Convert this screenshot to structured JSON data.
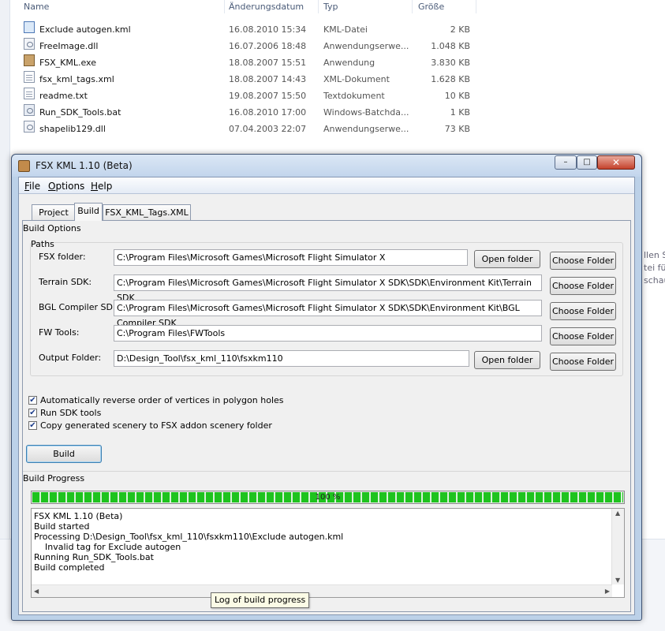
{
  "explorer": {
    "columns": {
      "name": "Name",
      "date": "Änderungsdatum",
      "type": "Typ",
      "size": "Größe"
    },
    "files": [
      {
        "icon": "kml-file-icon",
        "name": "Exclude autogen.kml",
        "date": "16.08.2010 15:34",
        "type": "KML-Datei",
        "size": "2 KB"
      },
      {
        "icon": "dll-file-icon",
        "name": "FreeImage.dll",
        "date": "16.07.2006 18:48",
        "type": "Anwendungserwe...",
        "size": "1.048 KB"
      },
      {
        "icon": "exe-file-icon",
        "name": "FSX_KML.exe",
        "date": "18.08.2007 15:51",
        "type": "Anwendung",
        "size": "3.830 KB"
      },
      {
        "icon": "xml-file-icon",
        "name": "fsx_kml_tags.xml",
        "date": "18.08.2007 14:43",
        "type": "XML-Dokument",
        "size": "1.628 KB"
      },
      {
        "icon": "txt-file-icon",
        "name": "readme.txt",
        "date": "19.08.2007 15:50",
        "type": "Textdokument",
        "size": "10 KB"
      },
      {
        "icon": "bat-file-icon",
        "name": "Run_SDK_Tools.bat",
        "date": "16.08.2010 17:00",
        "type": "Windows-Batchda...",
        "size": "1 KB"
      },
      {
        "icon": "dll-file-icon",
        "name": "shapelib129.dll",
        "date": "07.04.2003 22:07",
        "type": "Anwendungserwe...",
        "size": "73 KB"
      }
    ],
    "right_fragments": [
      "llen Si",
      "tei fü",
      "schau"
    ]
  },
  "window": {
    "title": "FSX KML 1.10 (Beta)",
    "controls": {
      "minimize": "–",
      "maximize": "□",
      "close": "✕"
    },
    "menu": [
      {
        "label": "File"
      },
      {
        "label": "Options"
      },
      {
        "label": "Help"
      }
    ],
    "tabs": [
      {
        "label": "Project",
        "active": false
      },
      {
        "label": "Build",
        "active": true
      },
      {
        "label": "FSX_KML_Tags.XML",
        "active": false
      }
    ],
    "build_options": {
      "group_label": "Build Options",
      "paths_label": "Paths",
      "paths": [
        {
          "label": "FSX folder:",
          "value": "C:\\Program Files\\Microsoft Games\\Microsoft Flight Simulator X",
          "open_button": "Open folder",
          "choose_button": "Choose Folder"
        },
        {
          "label": "Terrain SDK:",
          "value": "C:\\Program Files\\Microsoft Games\\Microsoft Flight Simulator X SDK\\SDK\\Environment Kit\\Terrain SDK",
          "choose_button": "Choose Folder"
        },
        {
          "label": "BGL Compiler SDK:",
          "value": "C:\\Program Files\\Microsoft Games\\Microsoft Flight Simulator X SDK\\SDK\\Environment Kit\\BGL Compiler SDK",
          "choose_button": "Choose Folder"
        },
        {
          "label": "FW Tools:",
          "value": "C:\\Program Files\\FWTools",
          "choose_button": "Choose Folder"
        },
        {
          "label": "Output Folder:",
          "value": "D:\\Design_Tool\\fsx_kml_110\\fsxkm110",
          "open_button": "Open folder",
          "choose_button": "Choose Folder"
        }
      ],
      "checkboxes": [
        {
          "label": "Automatically reverse order of vertices in polygon holes",
          "checked": true
        },
        {
          "label": "Run SDK tools",
          "checked": true
        },
        {
          "label": "Copy generated scenery to FSX addon scenery folder",
          "checked": true
        }
      ],
      "build_button": "Build"
    },
    "build_progress": {
      "group_label": "Build Progress",
      "percent": 100,
      "percent_text": "100 %",
      "progress_color": "#1ec31e",
      "log": [
        "FSX KML 1.10 (Beta)",
        "Build started",
        "Processing D:\\Design_Tool\\fsx_kml_110\\fsxkm110\\Exclude autogen.kml",
        "    Invalid tag for Exclude autogen",
        "Running Run_SDK_Tools.bat",
        "Build completed"
      ]
    },
    "tooltip": "Log of build progress"
  }
}
